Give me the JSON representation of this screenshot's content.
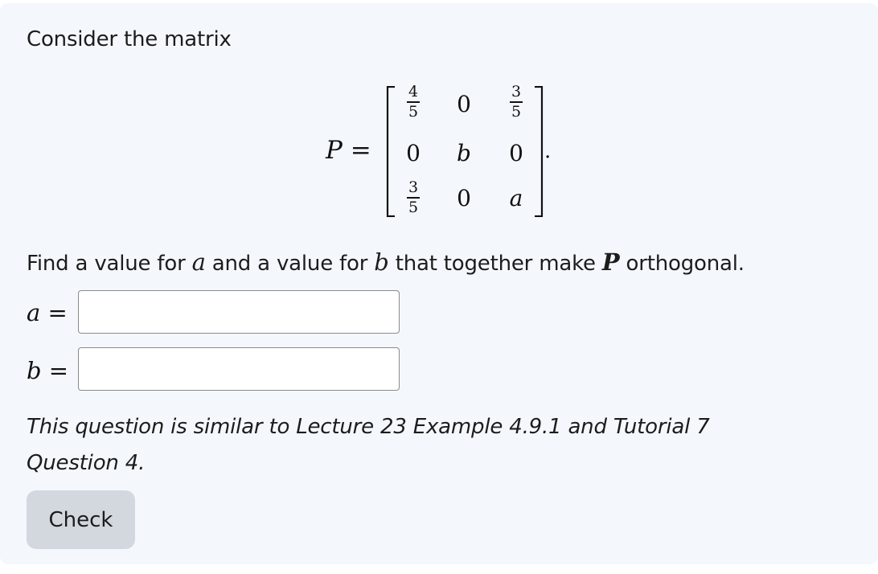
{
  "intro": "Consider the matrix",
  "matrix": {
    "label": "P =",
    "rows": [
      [
        {
          "num": "4",
          "den": "5"
        },
        "0",
        {
          "num": "3",
          "den": "5"
        }
      ],
      [
        "0",
        "b",
        "0"
      ],
      [
        {
          "num": "3",
          "den": "5"
        },
        "0",
        "a"
      ]
    ],
    "trailing": "."
  },
  "question": {
    "part1": "Find a value for ",
    "var_a": "a",
    "part2": " and a value for ",
    "var_b": "b",
    "part3": " that together make ",
    "var_p": "P",
    "part4": " orthogonal."
  },
  "inputs": {
    "a_label": "a =",
    "a_value": "",
    "b_label": "b =",
    "b_value": ""
  },
  "note": "This question is similar to Lecture 23 Example 4.9.1 and Tutorial 7 Question 4.",
  "check_label": "Check"
}
